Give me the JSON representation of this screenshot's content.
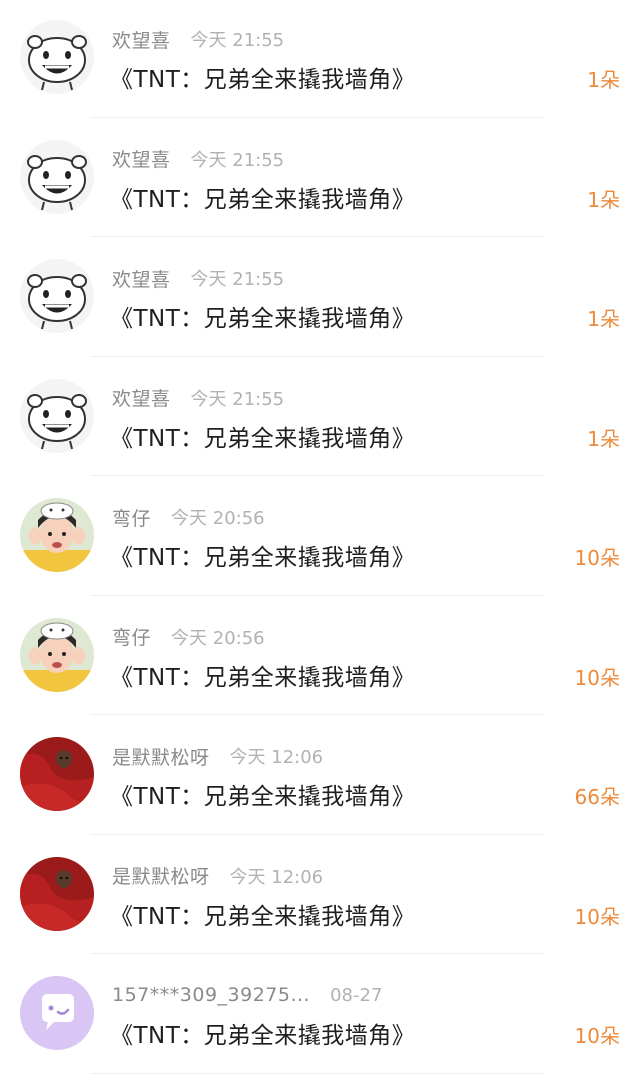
{
  "accent_color": "#ee8a3a",
  "rows": [
    {
      "user": "欢望喜",
      "time": "今天 21:55",
      "title": "《TNT：兄弟全来撬我墙角》",
      "count": "1朵",
      "avatar": "bear-sticker-avatar"
    },
    {
      "user": "欢望喜",
      "time": "今天 21:55",
      "title": "《TNT：兄弟全来撬我墙角》",
      "count": "1朵",
      "avatar": "bear-sticker-avatar"
    },
    {
      "user": "欢望喜",
      "time": "今天 21:55",
      "title": "《TNT：兄弟全来撬我墙角》",
      "count": "1朵",
      "avatar": "bear-sticker-avatar"
    },
    {
      "user": "欢望喜",
      "time": "今天 21:55",
      "title": "《TNT：兄弟全来撬我墙角》",
      "count": "1朵",
      "avatar": "bear-sticker-avatar"
    },
    {
      "user": "弯仔",
      "time": "今天 20:56",
      "title": "《TNT：兄弟全来撬我墙角》",
      "count": "10朵",
      "avatar": "person-photo-avatar"
    },
    {
      "user": "弯仔",
      "time": "今天 20:56",
      "title": "《TNT：兄弟全来撬我墙角》",
      "count": "10朵",
      "avatar": "person-photo-avatar"
    },
    {
      "user": "是默默松呀",
      "time": "今天 12:06",
      "title": "《TNT：兄弟全来撬我墙角》",
      "count": "66朵",
      "avatar": "red-cloth-avatar"
    },
    {
      "user": "是默默松呀",
      "time": "今天 12:06",
      "title": "《TNT：兄弟全来撬我墙角》",
      "count": "10朵",
      "avatar": "red-cloth-avatar"
    },
    {
      "user": "157***309_39275...",
      "time": "08-27",
      "title": "《TNT：兄弟全来撬我墙角》",
      "count": "10朵",
      "avatar": "chat-bubble-avatar"
    }
  ]
}
